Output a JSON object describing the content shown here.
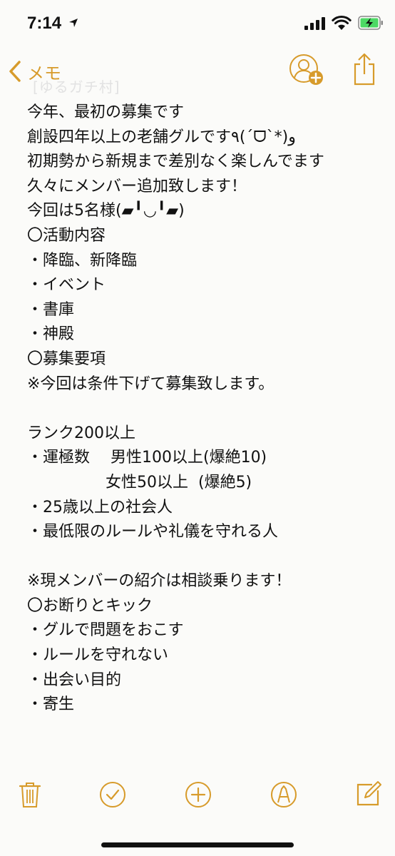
{
  "status_bar": {
    "time": "7:14"
  },
  "nav": {
    "back_label": "メモ",
    "ghost_title": "[ゆるガチ村]"
  },
  "note": {
    "lines": [
      "今年、最初の募集です",
      "創設四年以上の老舗グルです٩(ˊᗜˋ*)و",
      "初期勢から新規まで差別なく楽しんでます",
      "久々にメンバー追加致します！",
      "今回は5名様(▰╹◡╹▰)",
      "〇活動内容",
      "・降臨、新降臨",
      "・イベント",
      "・書庫",
      "・神殿",
      "〇募集要項",
      "※今回は条件下げて募集致します。",
      "",
      "ランク200以上",
      "・運極数　 男性100以上(爆絶10)",
      "　　　　　女性50以上  (爆絶5)",
      "・25歳以上の社会人",
      "・最低限のルールや礼儀を守れる人",
      "",
      "※現メンバーの紹介は相談乗ります！",
      "〇お断りとキック",
      "・グルで問題をおこす",
      "・ルールを守れない",
      "・出会い目的",
      "・寄生"
    ]
  },
  "colors": {
    "accent": "#d79b2b",
    "text": "#111111",
    "background": "#fbfbf9"
  },
  "toolbar": {
    "icons": [
      "trash-icon",
      "checklist-icon",
      "add-icon",
      "markup-icon",
      "compose-icon"
    ]
  }
}
